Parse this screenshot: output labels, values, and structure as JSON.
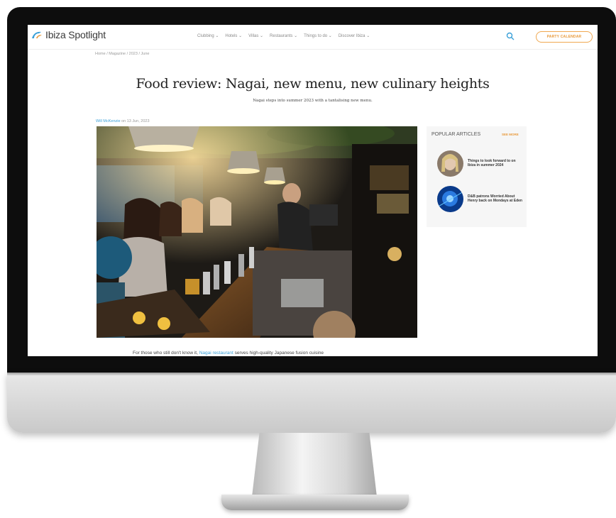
{
  "site": {
    "logo_text": "Ibiza Spotlight",
    "nav": [
      "Clubbing",
      "Hotels",
      "Villas",
      "Restaurants",
      "Things to do",
      "Discover Ibiza"
    ],
    "party_button": "PARTY CALENDAR"
  },
  "breadcrumb": "Home / Magazine / 2023 / June",
  "article": {
    "title": "Food review: Nagai, new menu, new culinary heights",
    "subtitle": "Nagai steps into summer 2023 with a tantalising new menu.",
    "author": "Will McKenzie",
    "date": "on 13 Jun, 2023",
    "body_start": "For those who still don't know it,",
    "body_link": "Nagai restaurant",
    "body_end": "serves high-quality Japanese fusion cuisine"
  },
  "sidebar": {
    "heading": "POPULAR ARTICLES",
    "see_more": "SEE MORE",
    "articles": [
      {
        "title": "Things to look forward to on Ibiza in summer 2024"
      },
      {
        "title": "D&B patrons Worried About Henry back on Mondays at Eden"
      }
    ]
  },
  "colors": {
    "accent_blue": "#3aa0d8",
    "accent_orange": "#e89a3c",
    "bezel": "#0d0d0d"
  }
}
